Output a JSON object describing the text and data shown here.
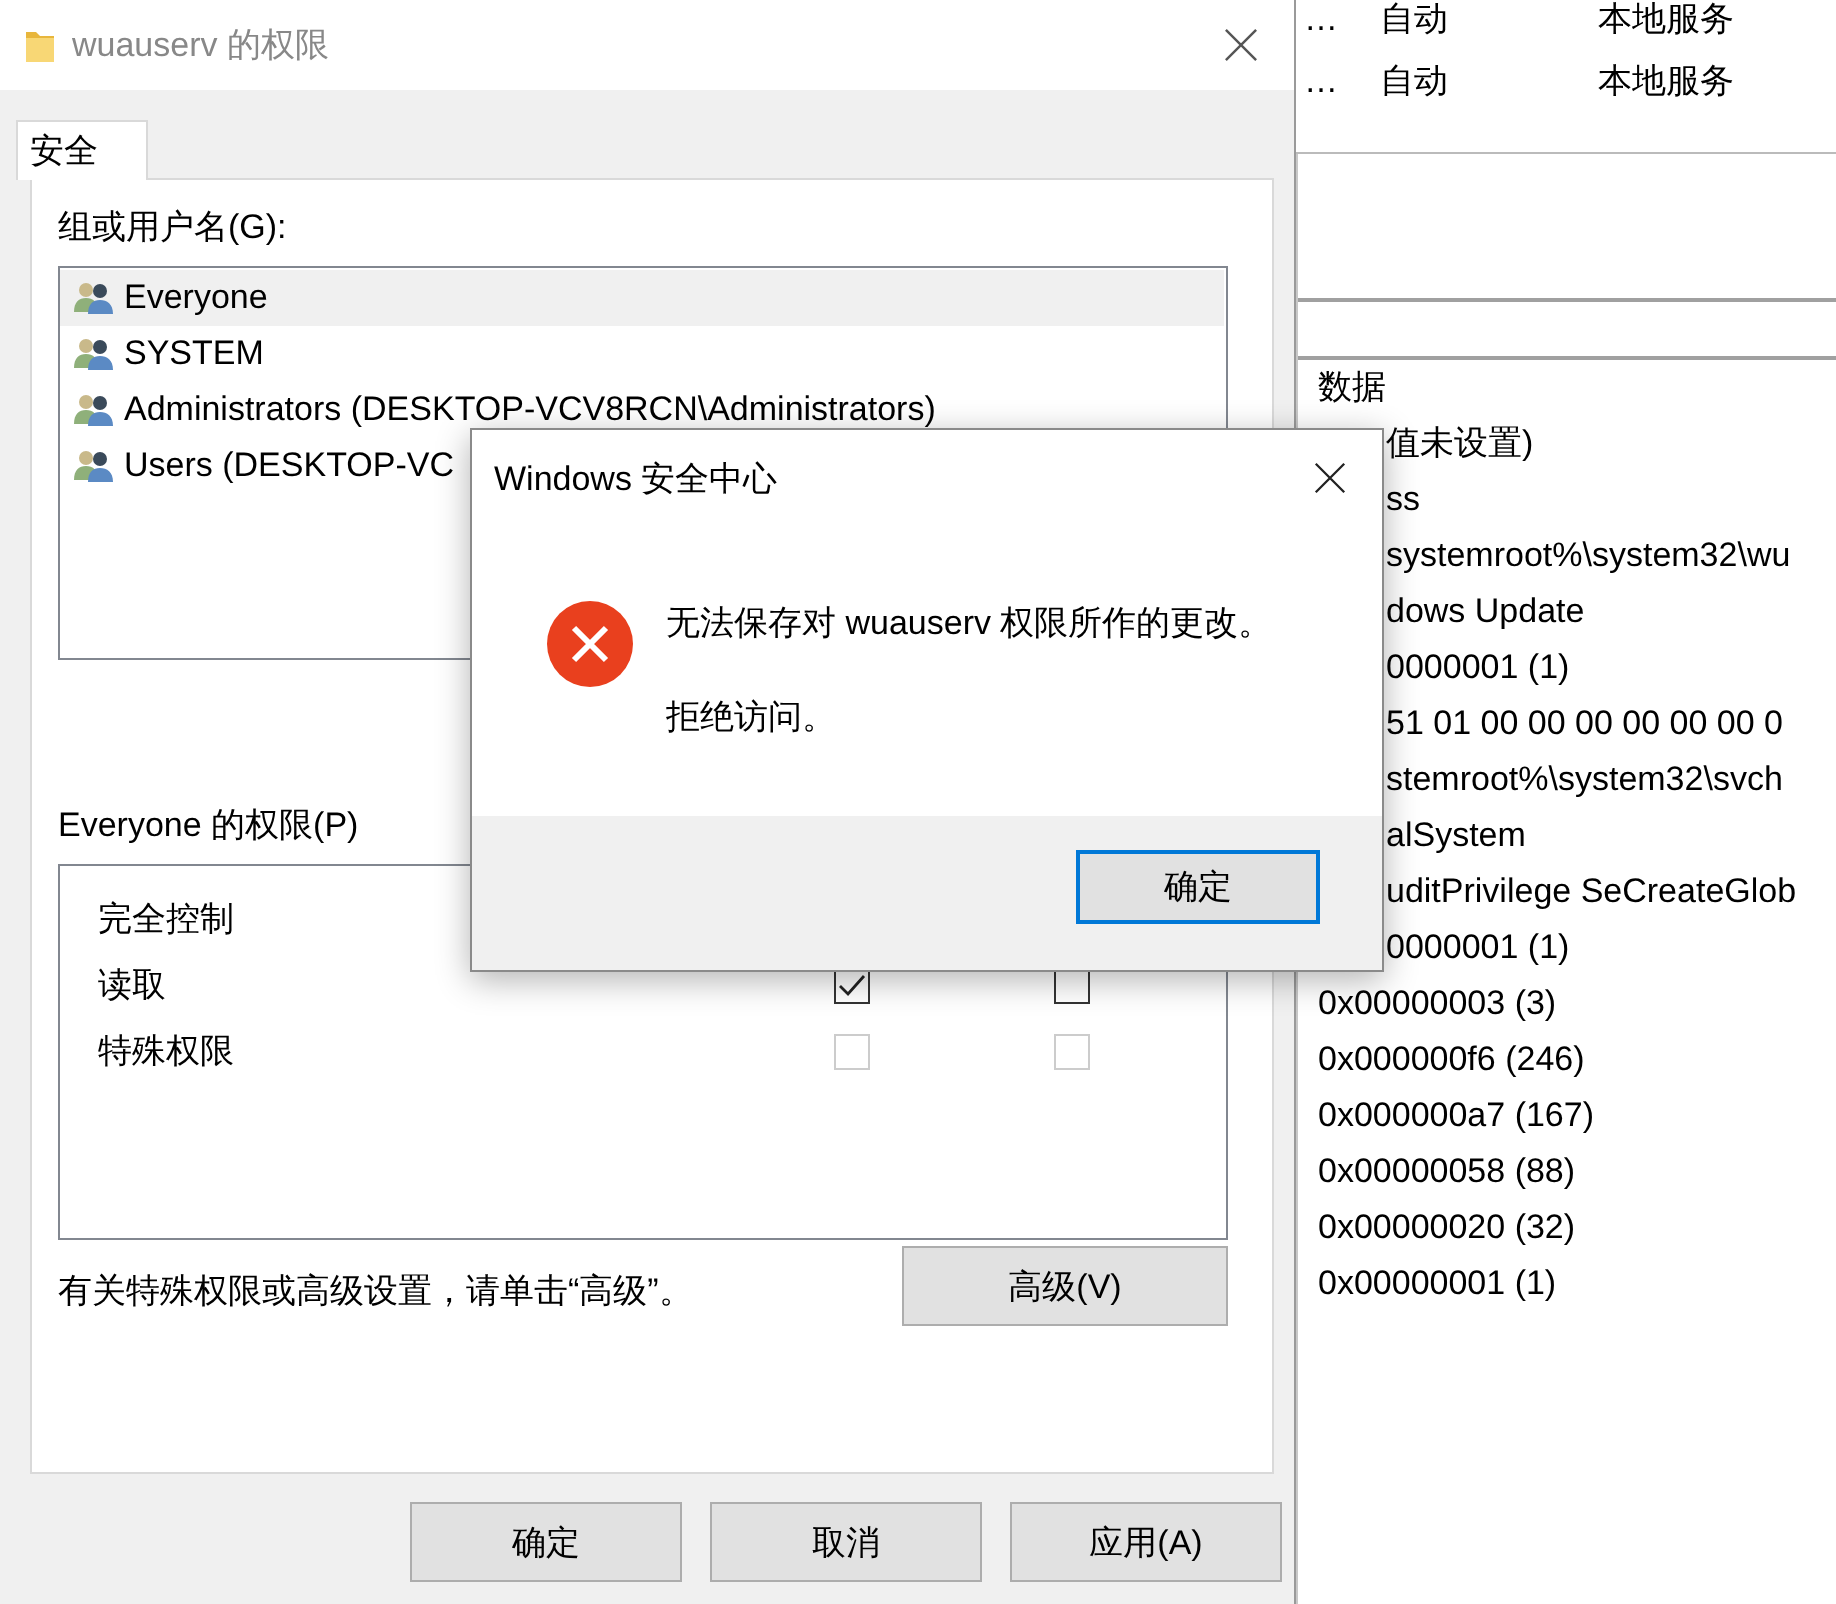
{
  "services_window": {
    "rows": [
      {
        "column_1": "…",
        "column_2": "自动",
        "column_3": "本地服务"
      },
      {
        "column_1": "…",
        "column_2": "自动",
        "column_3": "本地服务"
      }
    ]
  },
  "registry_window": {
    "column_header": "数据",
    "rows": [
      {
        "text": "值未设置)",
        "covered": true
      },
      {
        "text": "ss",
        "covered": true
      },
      {
        "text": "systemroot%\\system32\\wu",
        "covered": true
      },
      {
        "text": "dows Update",
        "covered": true
      },
      {
        "text": "0000001 (1)",
        "covered": true
      },
      {
        "text": "51 01 00 00 00 00 00 00 0",
        "covered": true
      },
      {
        "text": "stemroot%\\system32\\svch",
        "covered": true
      },
      {
        "text": "alSystem",
        "covered": true
      },
      {
        "text": "uditPrivilege SeCreateGlob",
        "covered": true
      },
      {
        "text": "0000001 (1)",
        "covered": true
      },
      {
        "text": "0x00000003 (3)",
        "covered": false
      },
      {
        "text": "0x000000f6 (246)",
        "covered": false
      },
      {
        "text": "0x000000a7 (167)",
        "covered": false
      },
      {
        "text": "0x00000058 (88)",
        "covered": false
      },
      {
        "text": "0x00000020 (32)",
        "covered": false
      },
      {
        "text": "0x00000001 (1)",
        "covered": false
      }
    ]
  },
  "permissions_window": {
    "title": "wuauserv 的权限",
    "tabs": [
      {
        "label": "安全",
        "selected": true
      }
    ],
    "groups_label": "组或用户名(G):",
    "users": [
      {
        "name": "Everyone",
        "selected": true
      },
      {
        "name": "SYSTEM",
        "selected": false
      },
      {
        "name": "Administrators (DESKTOP-VCV8RCN\\Administrators)",
        "selected": false
      },
      {
        "name": "Users (DESKTOP-VC",
        "selected": false
      }
    ],
    "permissions_label": "Everyone 的权限(P)",
    "permissions": [
      {
        "label": "完全控制"
      },
      {
        "label": "读取",
        "allow": {
          "checked": true,
          "disabled": false
        },
        "deny": {
          "checked": false,
          "disabled": false
        }
      },
      {
        "label": "特殊权限",
        "allow": {
          "checked": false,
          "disabled": true
        },
        "deny": {
          "checked": false,
          "disabled": true
        }
      }
    ],
    "advanced_note": "有关特殊权限或高级设置，请单击“高级”。",
    "advanced_button": "高级(V)",
    "buttons": [
      "确定",
      "取消",
      "应用(A)"
    ]
  },
  "error_dialog": {
    "title": "Windows 安全中心",
    "message": "无法保存对 wuauserv 权限所作的更改。",
    "detail": "拒绝访问。",
    "button": "确定"
  }
}
